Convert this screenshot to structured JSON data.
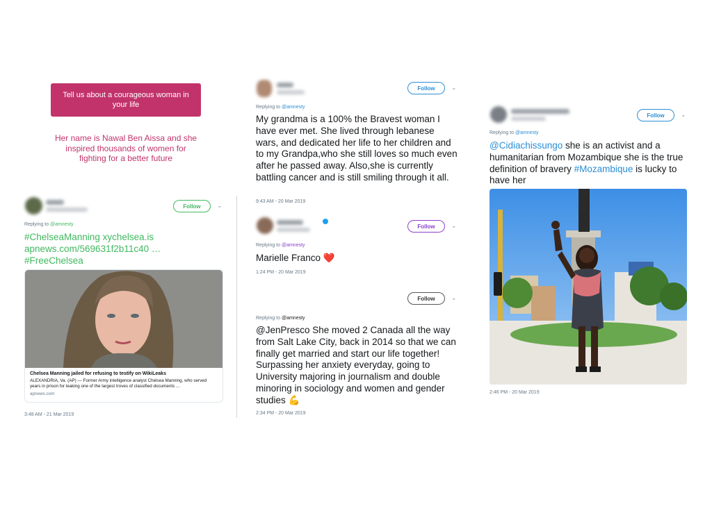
{
  "story": {
    "prompt": "Tell us about a courageous woman in your life",
    "answer": "Her name is Nawal Ben Aissa and she inspired thousands of women for fighting for a better future"
  },
  "colors": {
    "story_pink": "#c2336b",
    "follow_green": "#3fb95f",
    "follow_blue": "#2a8ed6",
    "follow_purple": "#8b3fc9",
    "text_dark": "#14171a",
    "meta_gray": "#657786"
  },
  "tweet1": {
    "follow_label": "Follow",
    "replying_prefix": "Replying to ",
    "replying_handle": "@amnesty",
    "text_line1": "#ChelseaManning xychelsea.is",
    "text_line2": "apnews.com/569631f2b11c40 …",
    "text_line3": "#FreeChelsea",
    "card": {
      "title": "Chelsea Manning jailed for refusing to testify on WikiLeaks",
      "description": "ALEXANDRIA, Va. (AP) — Former Army intelligence analyst Chelsea Manning, who served years in prison for leaking one of the largest troves of classified documents ...",
      "domain": "apnews.com"
    },
    "timestamp": "3:48 AM - 21 Mar 2019"
  },
  "tweet2": {
    "follow_label": "Follow",
    "replying_prefix": "Replying to ",
    "replying_handle": "@amnesty",
    "text": "My grandma is a 100% the Bravest woman I have ever met. She lived through lebanese wars, and dedicated her life to her children and to my Grandpa,who she still loves so much even after he passed away. Also,she is currently battling cancer and is still smiling through it all.",
    "timestamp": "9:43 AM - 20 Mar 2019"
  },
  "tweet3": {
    "follow_label": "Follow",
    "replying_prefix": "Replying to ",
    "replying_handle": "@amnesty",
    "text": "Marielle Franco",
    "emoji": "❤️",
    "timestamp": "1:24 PM - 20 Mar 2019"
  },
  "tweet4": {
    "follow_label": "Follow",
    "replying_prefix": "Replying to ",
    "replying_handle": "@amnesty",
    "text_mention": "@JenPresco",
    "text_body": " She moved 2 Canada all the way from Salt Lake City, back in 2014 so that we can finally get married and start our life together! Surpassing her anxiety everyday, going to University majoring in journalism and double minoring in sociology and women and gender studies ",
    "emoji": "💪",
    "timestamp": "2:34 PM - 20 Mar 2019"
  },
  "tweet5": {
    "follow_label": "Follow",
    "replying_prefix": "Replying to ",
    "replying_handle": "@amnesty",
    "text_mention": "@Cidiachissungo",
    "text_body1": " she is an activist and a humanitarian from Mozambique she is the true definition of bravery ",
    "text_hashtag": "#Mozambique",
    "text_body2": " is lucky to have her",
    "timestamp": "2:46 PM - 20 Mar 2019"
  }
}
